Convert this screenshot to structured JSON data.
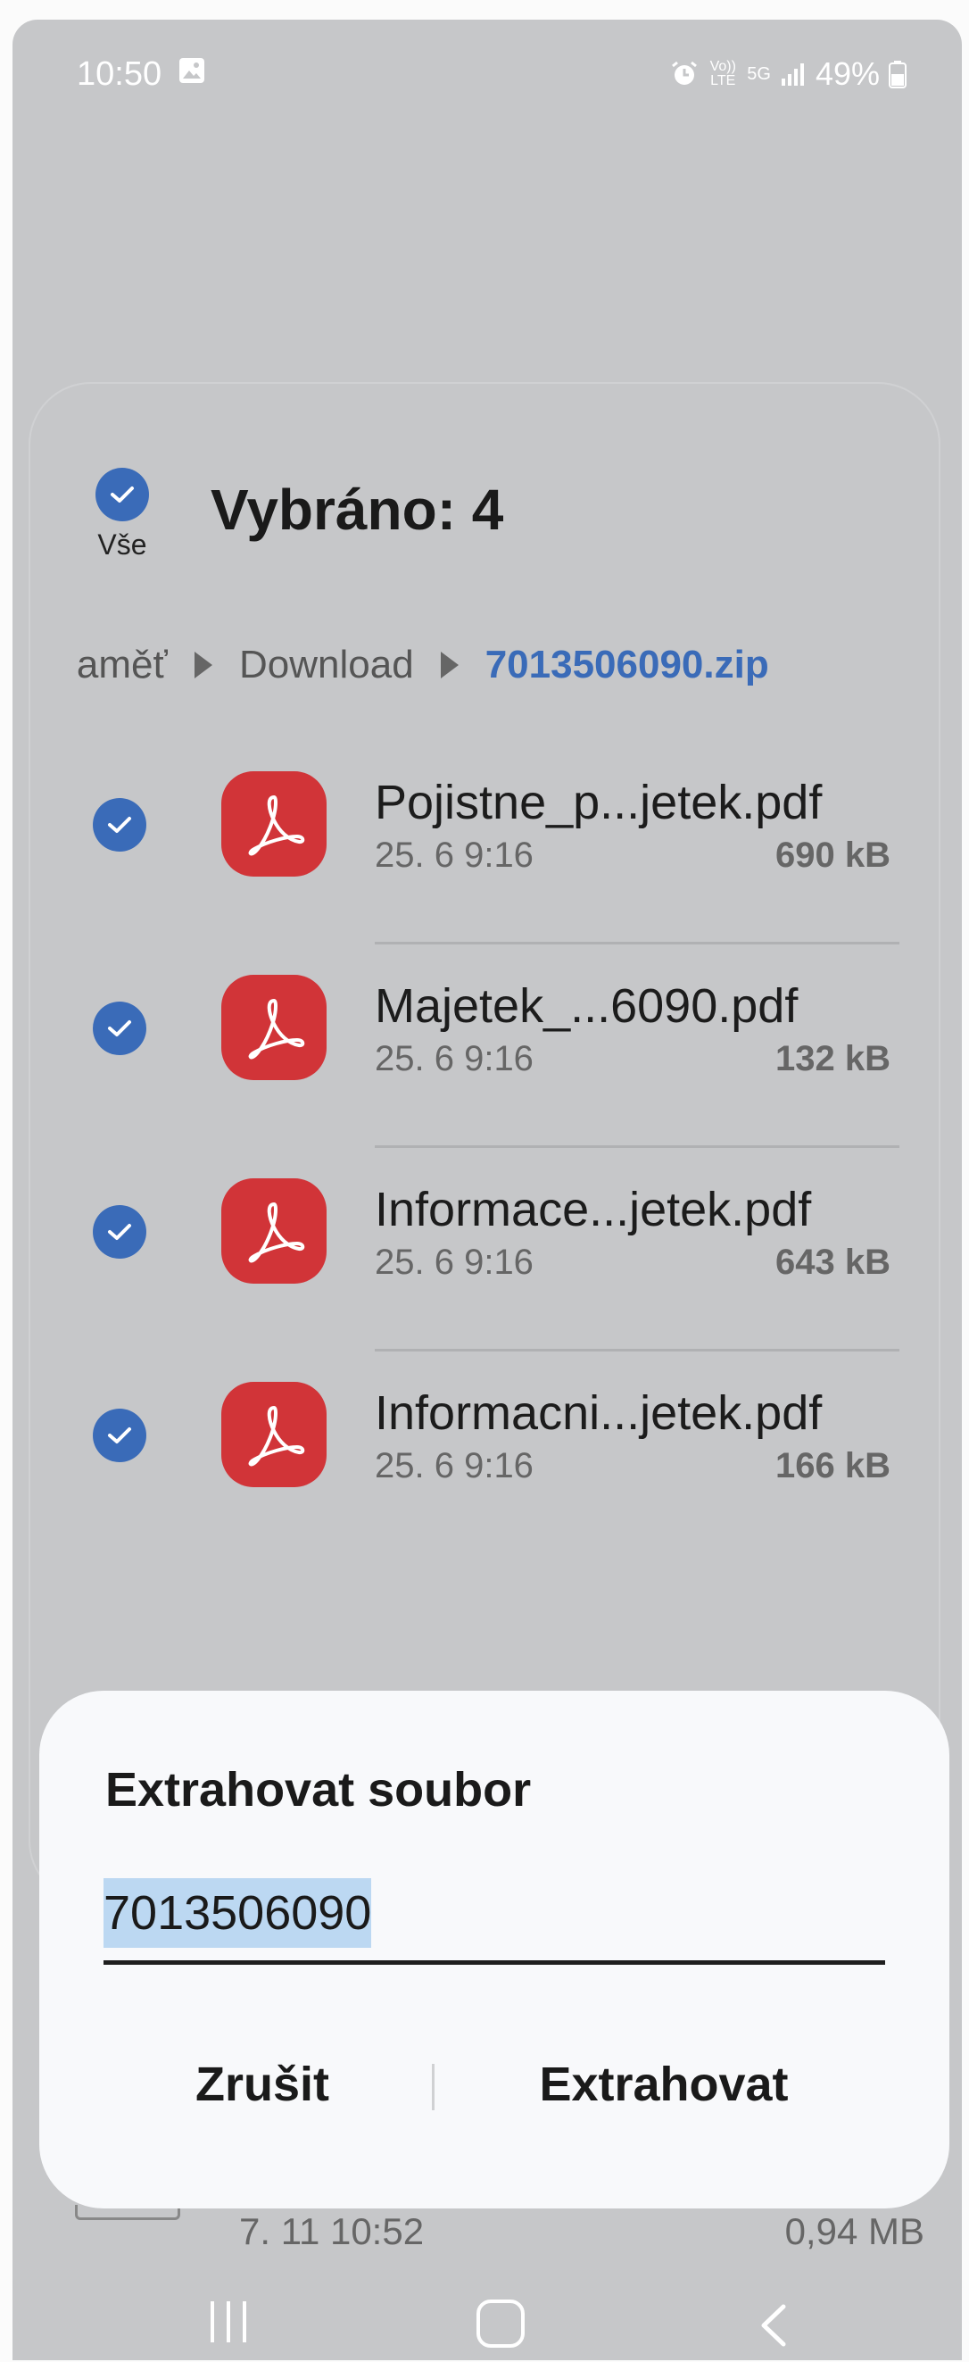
{
  "status_bar": {
    "time": "10:50",
    "battery": "49%",
    "network_5g": "5G",
    "volte_label": "Vo)) LTE"
  },
  "header": {
    "select_all_label": "Vše",
    "selected_title": "Vybráno: 4"
  },
  "breadcrumb": {
    "items": [
      "paměť",
      "Download",
      "7013506090.zip"
    ]
  },
  "files": [
    {
      "name": "Pojistne_p...jetek.pdf",
      "date": "25. 6 9:16",
      "size": "690 kB"
    },
    {
      "name": "Majetek_...6090.pdf",
      "date": "25. 6 9:16",
      "size": "132 kB"
    },
    {
      "name": "Informace...jetek.pdf",
      "date": "25. 6 9:16",
      "size": "643 kB"
    },
    {
      "name": "Informacni...jetek.pdf",
      "date": "25. 6 9:16",
      "size": "166 kB"
    }
  ],
  "background_item": {
    "date": "7. 11 10:52",
    "size": "0,94 MB"
  },
  "dialog": {
    "title": "Extrahovat soubor",
    "input_value": "7013506090",
    "cancel_label": "Zrušit",
    "confirm_label": "Extrahovat"
  },
  "colors": {
    "accent": "#3a6bb8",
    "pdf_icon": "#d13438",
    "scrim": "#c6c7c9",
    "dialog": "#f8f9fb"
  }
}
